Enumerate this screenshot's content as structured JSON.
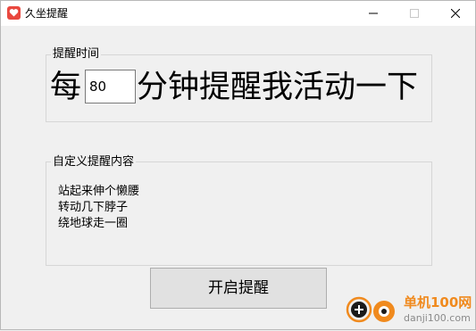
{
  "window": {
    "title": "久坐提醒",
    "controls": {
      "minimize": "minimize-icon",
      "maximize": "maximize-icon",
      "close": "close-icon"
    }
  },
  "reminder_time": {
    "legend": "提醒时间",
    "prefix": "每",
    "minutes_value": "80",
    "suffix": "分钟提醒我活动一下"
  },
  "reminder_content": {
    "legend": "自定义提醒内容",
    "lines": [
      "站起来伸个懒腰",
      "转动几下脖子",
      "绕地球走一圈"
    ]
  },
  "start_button": {
    "label": "开启提醒"
  },
  "watermark": {
    "text": "单机100网",
    "url": "danji100.com"
  },
  "colors": {
    "app_icon": "#e9483f",
    "watermark": "#f08a1e"
  }
}
